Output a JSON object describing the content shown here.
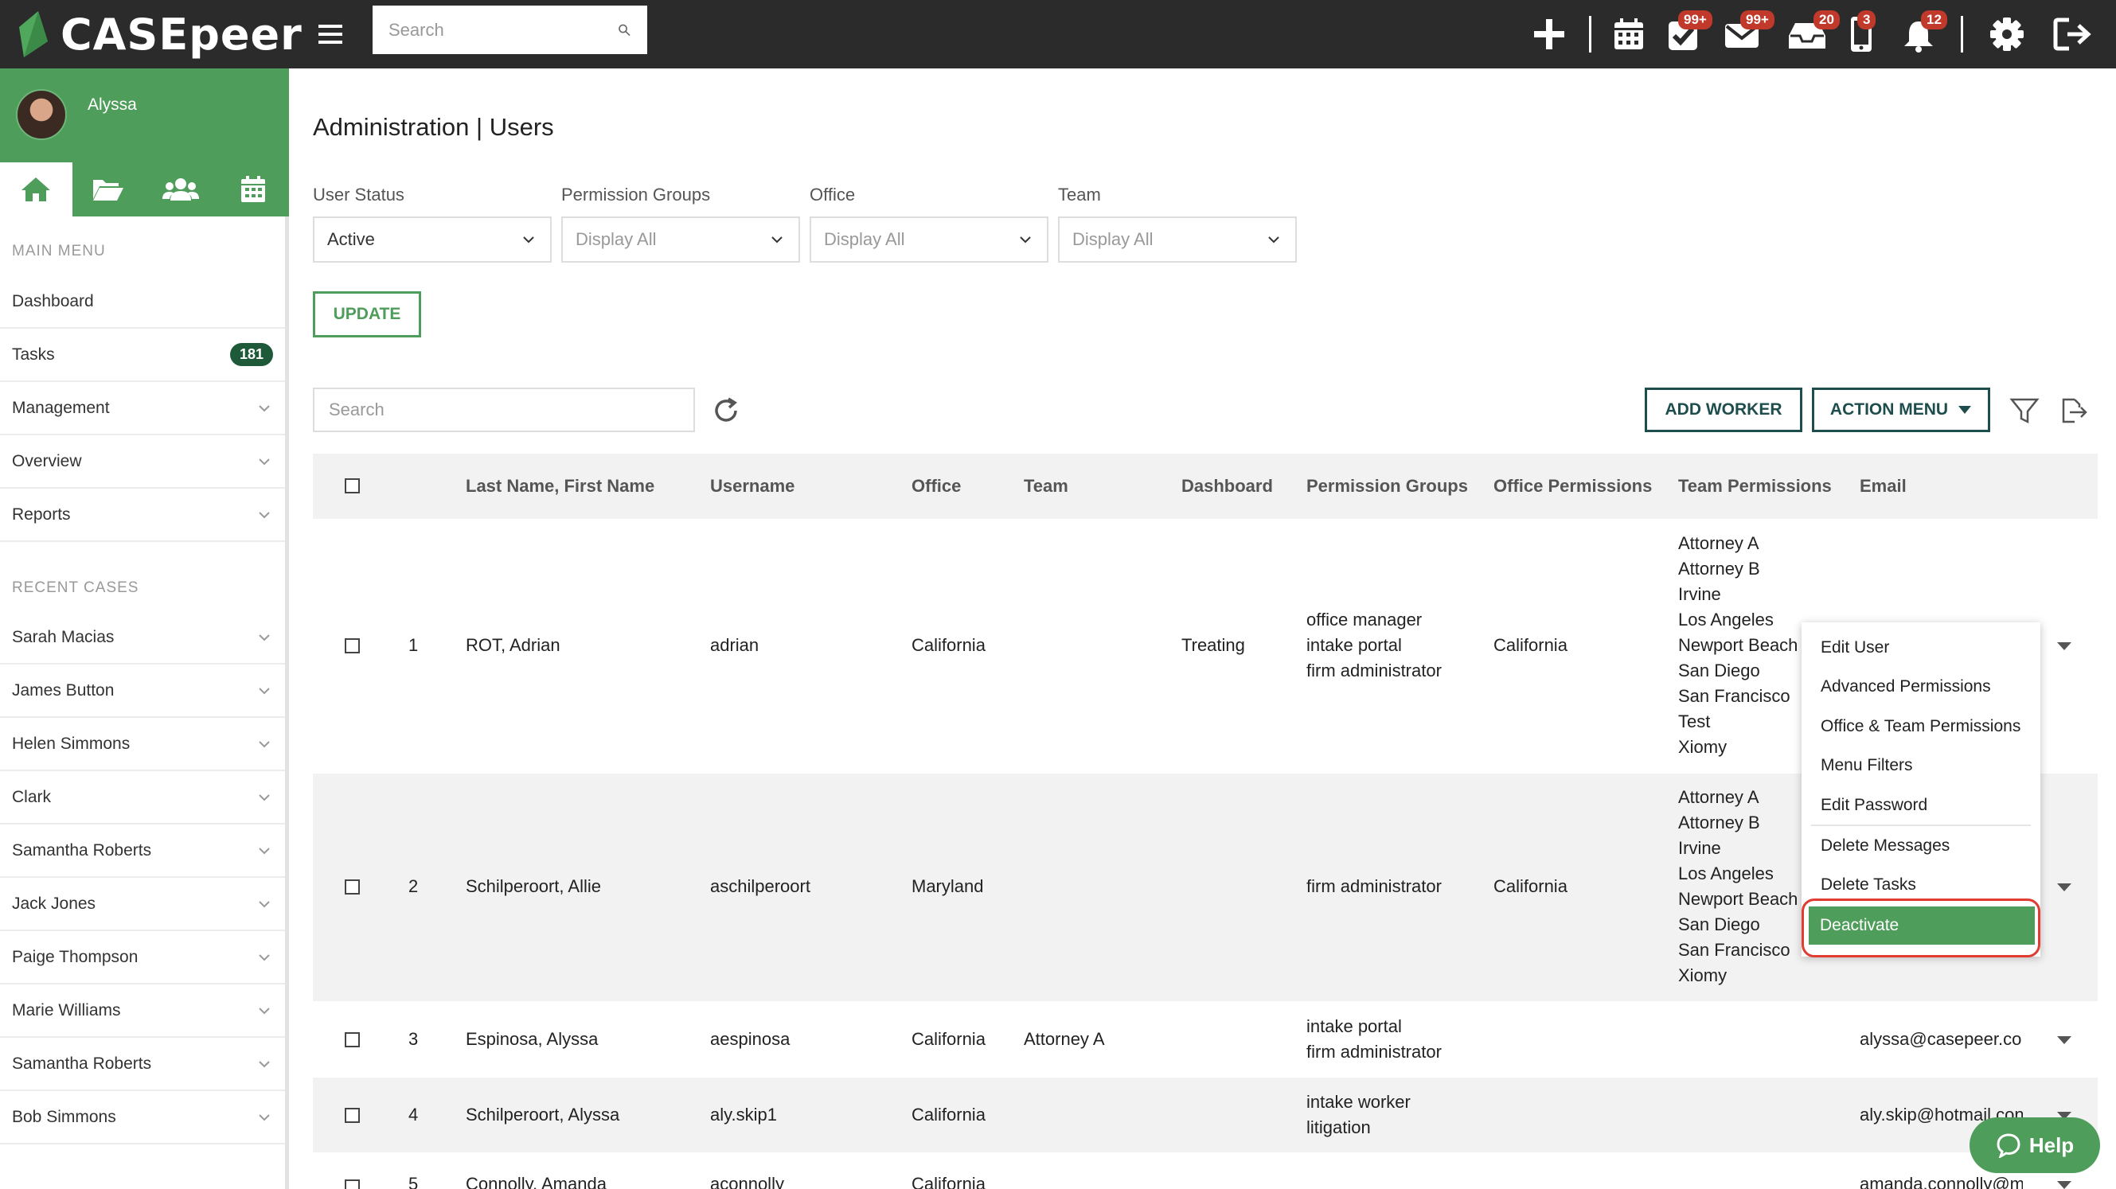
{
  "app": {
    "name": "CASEpeer"
  },
  "topbar": {
    "search_placeholder": "Search",
    "badges": {
      "tasks": "99+",
      "mail": "99+",
      "inbox": "20",
      "phone": "3",
      "bell": "12"
    }
  },
  "sidebar": {
    "user_name": "Alyssa",
    "main_menu_heading": "MAIN MENU",
    "main_menu": [
      {
        "label": "Dashboard"
      },
      {
        "label": "Tasks",
        "badge": "181"
      },
      {
        "label": "Management"
      },
      {
        "label": "Overview"
      },
      {
        "label": "Reports"
      }
    ],
    "recent_heading": "RECENT CASES",
    "recent_cases": [
      "Sarah Macias",
      "James Button",
      "Helen Simmons",
      "Clark",
      "Samantha Roberts",
      "Jack Jones",
      "Paige Thompson",
      "Marie Williams",
      "Samantha Roberts",
      "Bob Simmons"
    ]
  },
  "page": {
    "title": "Administration | Users",
    "filters": [
      {
        "label": "User Status",
        "value": "Active"
      },
      {
        "label": "Permission Groups",
        "value": "Display All"
      },
      {
        "label": "Office",
        "value": "Display All"
      },
      {
        "label": "Team",
        "value": "Display All"
      }
    ],
    "update_label": "UPDATE",
    "table_search_placeholder": "Search",
    "add_worker_label": "ADD WORKER",
    "action_menu_label": "ACTION MENU"
  },
  "table": {
    "columns": [
      "Last Name, First Name",
      "Username",
      "Office",
      "Team",
      "Dashboard",
      "Permission Groups",
      "Office Permissions",
      "Team Permissions",
      "Email"
    ],
    "rows": [
      {
        "num": "1",
        "name": "ROT, Adrian",
        "username": "adrian",
        "office": "California",
        "team": "",
        "dashboard": "Treating",
        "groups": [
          "office manager",
          "intake portal",
          "firm administrator"
        ],
        "office_perm": "California",
        "team_perm": [
          "Attorney A",
          "Attorney B",
          "Irvine",
          "Los Angeles",
          "Newport Beach",
          "San Diego",
          "San Francisco",
          "Test",
          "Xiomy"
        ],
        "email": ""
      },
      {
        "num": "2",
        "name": "Schilperoort, Allie",
        "username": "aschilperoort",
        "office": "Maryland",
        "team": "",
        "dashboard": "",
        "groups": [
          "firm administrator"
        ],
        "office_perm": "California",
        "team_perm": [
          "Attorney A",
          "Attorney B",
          "Irvine",
          "Los Angeles",
          "Newport Beach",
          "San Diego",
          "San Francisco",
          "Xiomy"
        ],
        "email": ""
      },
      {
        "num": "3",
        "name": "Espinosa, Alyssa",
        "username": "aespinosa",
        "office": "California",
        "team": "Attorney A",
        "dashboard": "",
        "groups": [
          "intake portal",
          "firm administrator"
        ],
        "office_perm": "",
        "team_perm": [],
        "email": "alyssa@casepeer.coı"
      },
      {
        "num": "4",
        "name": "Schilperoort, Alyssa",
        "username": "aly.skip1",
        "office": "California",
        "team": "",
        "dashboard": "",
        "groups": [
          "intake worker",
          "litigation"
        ],
        "office_perm": "",
        "team_perm": [],
        "email": "aly.skip@hotmail.con"
      },
      {
        "num": "5",
        "name": "Connolly, Amanda",
        "username": "aconnolly",
        "office": "California",
        "team": "",
        "dashboard": "",
        "groups": [],
        "office_perm": "",
        "team_perm": [],
        "email": "amanda.connolly@m"
      }
    ]
  },
  "dropdown": {
    "items": [
      "Edit User",
      "Advanced Permissions",
      "Office & Team Permissions",
      "Menu Filters",
      "Edit Password",
      "Delete Messages",
      "Delete Tasks"
    ],
    "highlighted": "Deactivate"
  },
  "help_label": "Help",
  "colors": {
    "brand_green": "#4f9d5b",
    "dark": "#2b2b2b",
    "teal": "#1e4d4d",
    "badge_red": "#c0392b",
    "highlight_red": "#e03c31"
  }
}
